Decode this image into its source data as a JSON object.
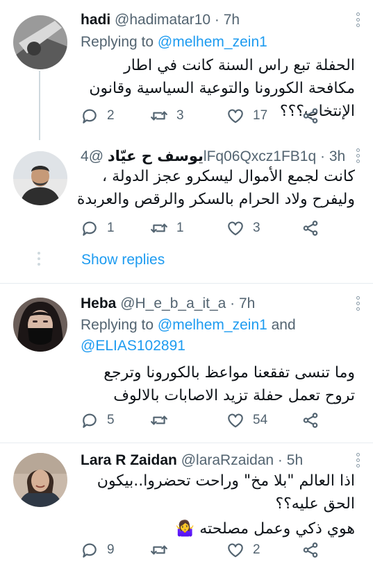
{
  "tweets": [
    {
      "name": "hadi",
      "handle": "@hadimatar10 · 7h",
      "replying_prefix": "Replying to ",
      "replying_to": "@melhem_zein1",
      "text": "الحفلة تبع راس السنة كانت في اطار مكافحة الكورونا والتوعية السياسية وقانون الإنتخاب؟؟؟",
      "replies": "2",
      "retweets": "3",
      "likes": "17"
    },
    {
      "name": "يوسف ح عيّاد",
      "handle": "@4lFq06Qxcz1FB1q · 3h",
      "text": "كانت لجمع الأموال ليسكرو عجز الدولة ، وليفرح ولاد الحرام بالسكر والرقص والعربدة",
      "replies": "1",
      "retweets": "1",
      "likes": "3"
    },
    {
      "name": "Heba",
      "handle": "@H_e_b_a_it_a · 7h",
      "replying_prefix": "Replying to ",
      "replying_to": "@melhem_zein1",
      "replying_and": " and",
      "replying_to_2": "@ELIAS102891",
      "text": "وما تنسى تفقعنا مواعظ بالكورونا وترجع تروح تعمل حفلة تزيد الاصابات بالالوف",
      "replies": "5",
      "retweets": "",
      "likes": "54"
    },
    {
      "name": "Lara R Zaidan",
      "handle": "@laraRzaidan · 5h",
      "text_line1": "اذا العالم \"بلا مخ\" وراحت تحضروا..بيكون الحق عليه؟؟",
      "text_line2": "هوي ذكي وعمل مصلحته 🤷‍♀️",
      "replies": "9",
      "retweets": "",
      "likes": "2"
    }
  ],
  "show_replies": "Show replies",
  "icons": [
    "reply-icon",
    "retweet-icon",
    "like-icon",
    "share-icon",
    "more-icon"
  ],
  "colors": {
    "accent": "#1d9bf0",
    "secondary_text": "#536471",
    "divider": "#e6ecf0"
  }
}
